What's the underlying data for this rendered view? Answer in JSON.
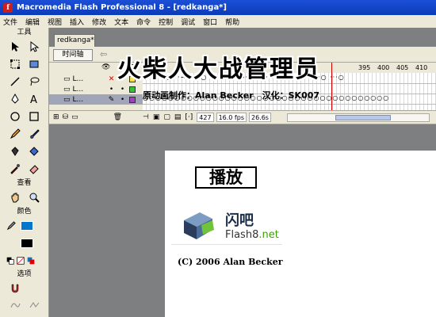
{
  "window": {
    "title": "Macromedia Flash Professional 8 - [redkanga*]"
  },
  "menu": [
    "文件",
    "编辑",
    "视图",
    "插入",
    "修改",
    "文本",
    "命令",
    "控制",
    "调试",
    "窗口",
    "帮助"
  ],
  "tools": {
    "header": "工具",
    "view_label": "查看",
    "colors_label": "颜色",
    "options_label": "选项",
    "items": [
      "selection-tool",
      "subselect-tool",
      "free-transform-tool",
      "fill-transform-tool",
      "line-tool",
      "lasso-tool",
      "pen-tool",
      "text-tool",
      "oval-tool",
      "rectangle-tool",
      "pencil-tool",
      "brush-tool",
      "ink-bottle-tool",
      "paint-bucket-tool",
      "eyedropper-tool",
      "eraser-tool"
    ],
    "stroke_color": "#000000",
    "fill_color": "#0077cc"
  },
  "document": {
    "tab": "redkanga*",
    "timeline_button": "时间轴",
    "ruler_numbers": [
      "395",
      "400",
      "405",
      "410"
    ],
    "layers": [
      {
        "name": "L...",
        "color": "#f5e642"
      },
      {
        "name": "L...",
        "color": "#34c334"
      },
      {
        "name": "L...",
        "color": "#a040c0"
      }
    ],
    "status": {
      "frame": "427",
      "fps": "16.0 fps",
      "time": "26.6s"
    },
    "credit": "原动画制作：Alan Becker　汉化：SK007"
  },
  "overlay_title": "火柴人大战管理员",
  "stage": {
    "play_button": "播放",
    "logo_cn": "闪吧",
    "logo_en": "Flash8",
    "logo_en_suffix": ".net",
    "copyright": "(C) 2006 Alan Becker"
  }
}
